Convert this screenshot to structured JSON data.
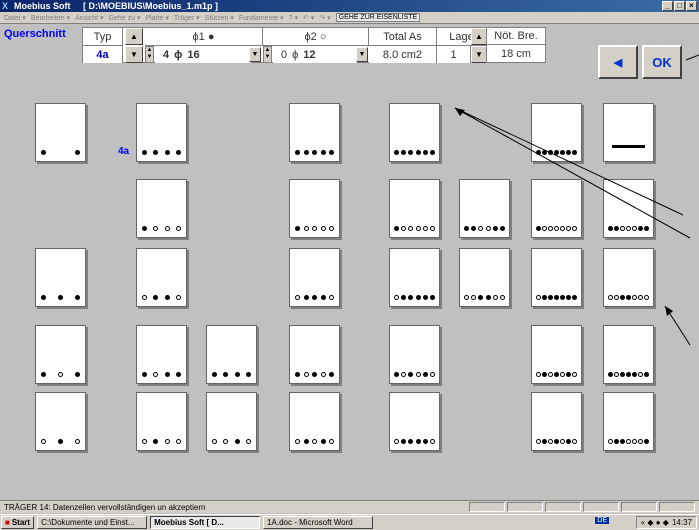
{
  "window": {
    "title": "Moebius Soft     [ D:\\MOEBIUS\\Moebius_1.m1p ]",
    "icon": "x-app-icon",
    "controls": [
      "_",
      "□",
      "×"
    ]
  },
  "menu": {
    "items": [
      "Datei ▾",
      "Bearbeiten ▾",
      "Ansicht ▾",
      "Gehe zu ▾",
      "Platte ▾",
      "Träger ▾",
      "Stützen ▾",
      "Fundamente ▾",
      "? ▾",
      "↶ ▾",
      "↷ ▾"
    ],
    "goto_label": "GEHE ZUR EISENLISTE"
  },
  "querschnitt_label": "Querschnitt",
  "panel": {
    "typ_header": "Typ",
    "typ_value": "4a",
    "phi1_header": "ϕ1 ●",
    "phi1_count": "4",
    "phi1_symbol": "ϕ",
    "phi1_diameter": "16",
    "phi2_header": "ϕ2 ○",
    "phi2_count": "0",
    "phi2_symbol": "ϕ",
    "phi2_diameter": "12",
    "total_header": "Total As",
    "total_value": "8.0 cm2",
    "lage_header": "Lage",
    "lage_value": "1",
    "nbre_header": "Nöt. Bre.",
    "nbre_value": "18 cm"
  },
  "buttons": {
    "back_glyph": "◀",
    "ok_label": "OK"
  },
  "grid": {
    "selected_tag": "4a",
    "sections": [
      {
        "col": 0,
        "row": 0,
        "bars": "f..f",
        "kind": "spaced"
      },
      {
        "col": 1,
        "row": 0,
        "bars": "ffff"
      },
      {
        "col": 3,
        "row": 0,
        "bars": "fffff"
      },
      {
        "col": 4,
        "row": 0,
        "bars": "ffffff"
      },
      {
        "col": 6,
        "row": 0,
        "bars": "fffffff"
      },
      {
        "col": 7,
        "row": 0,
        "bars": "",
        "kind": "plate"
      },
      {
        "col": 1,
        "row": 1,
        "bars": "fooo"
      },
      {
        "col": 3,
        "row": 1,
        "bars": "foooo"
      },
      {
        "col": 4,
        "row": 1,
        "bars": "fooooo"
      },
      {
        "col": 5,
        "row": 1,
        "bars": "ffooff"
      },
      {
        "col": 6,
        "row": 1,
        "bars": "foooooo"
      },
      {
        "col": 7,
        "row": 1,
        "bars": "ffoooff"
      },
      {
        "col": 0,
        "row": 2,
        "bars": "fff"
      },
      {
        "col": 1,
        "row": 2,
        "bars": "offo"
      },
      {
        "col": 3,
        "row": 2,
        "bars": "offfo"
      },
      {
        "col": 4,
        "row": 2,
        "bars": "offfff"
      },
      {
        "col": 5,
        "row": 2,
        "bars": "ooffoo"
      },
      {
        "col": 6,
        "row": 2,
        "bars": "offffff"
      },
      {
        "col": 7,
        "row": 2,
        "bars": "ooffooo"
      },
      {
        "col": 0,
        "row": 3,
        "bars": "fof"
      },
      {
        "col": 1,
        "row": 3,
        "bars": "foff"
      },
      {
        "col": 2,
        "row": 3,
        "bars": "ffff"
      },
      {
        "col": 3,
        "row": 3,
        "bars": "fofof"
      },
      {
        "col": 4,
        "row": 3,
        "bars": "fofofo"
      },
      {
        "col": 6,
        "row": 3,
        "bars": "ofofofo"
      },
      {
        "col": 7,
        "row": 3,
        "bars": "fofffof"
      },
      {
        "col": 0,
        "row": 4,
        "bars": "ofo"
      },
      {
        "col": 1,
        "row": 4,
        "bars": "ofoo"
      },
      {
        "col": 2,
        "row": 4,
        "bars": "oofo"
      },
      {
        "col": 3,
        "row": 4,
        "bars": "ofofo"
      },
      {
        "col": 4,
        "row": 4,
        "bars": "offffo"
      },
      {
        "col": 6,
        "row": 4,
        "bars": "ofofofo"
      },
      {
        "col": 7,
        "row": 4,
        "bars": "offooof"
      }
    ]
  },
  "status": {
    "text": "TRÄGER 14: Datenzellen vervollständigen un akzeptiern"
  },
  "taskbar": {
    "start_label": "Start",
    "tasks": [
      {
        "label": "C:\\Dokumente und Einst...",
        "active": false
      },
      {
        "label": "Moebius Soft    [ D...",
        "active": true
      },
      {
        "label": "1A.doc - Microsoft Word",
        "active": false
      }
    ],
    "lang": "DE",
    "clock": "14:37"
  }
}
